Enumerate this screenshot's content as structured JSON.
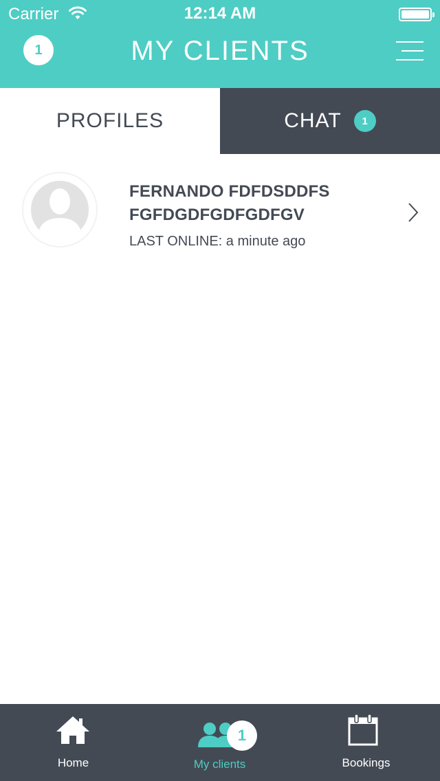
{
  "status_bar": {
    "carrier": "Carrier",
    "time": "12:14 AM"
  },
  "header": {
    "notification_count": "1",
    "title": "MY CLIENTS",
    "menu_icon": "hamburger-menu-icon"
  },
  "tabs": [
    {
      "label": "PROFILES",
      "active": false
    },
    {
      "label": "CHAT",
      "active": true,
      "badge": "1"
    }
  ],
  "clients": [
    {
      "name": "FERNANDO FDFDSDDFS FGFDGDFGDFGDFGV",
      "last_online": "LAST ONLINE: a minute ago"
    }
  ],
  "tabbar": {
    "items": [
      {
        "label": "Home",
        "icon": "home-icon"
      },
      {
        "label": "My clients",
        "icon": "clients-icon",
        "badge": "1",
        "active": true
      },
      {
        "label": "Bookings",
        "icon": "calendar-icon"
      }
    ]
  },
  "colors": {
    "accent": "#4ecdc4",
    "dark": "#434a54",
    "white": "#ffffff"
  }
}
